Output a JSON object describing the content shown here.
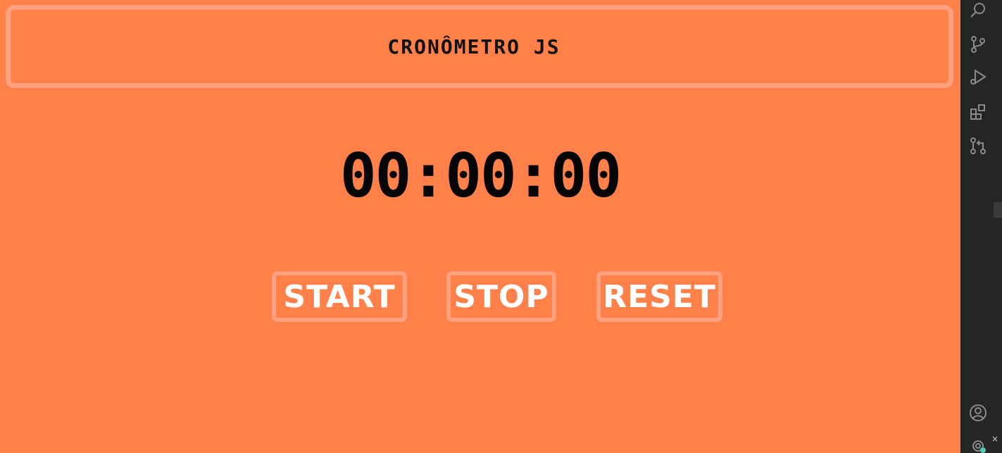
{
  "header": {
    "title": "CRONÔMETRO JS"
  },
  "timer": {
    "display": "00:00:00"
  },
  "controls": {
    "start_label": "START",
    "stop_label": "STOP",
    "reset_label": "RESET"
  },
  "activity_bar": {
    "icons": [
      "search-icon",
      "source-control-icon",
      "run-debug-icon",
      "extensions-icon",
      "pull-request-icon",
      "account-icon",
      "settings-gear-icon"
    ],
    "close_glyph": "×"
  },
  "colors": {
    "background": "#ff8049",
    "border_accent": "#ffa07e",
    "activity_bar": "#252526"
  }
}
